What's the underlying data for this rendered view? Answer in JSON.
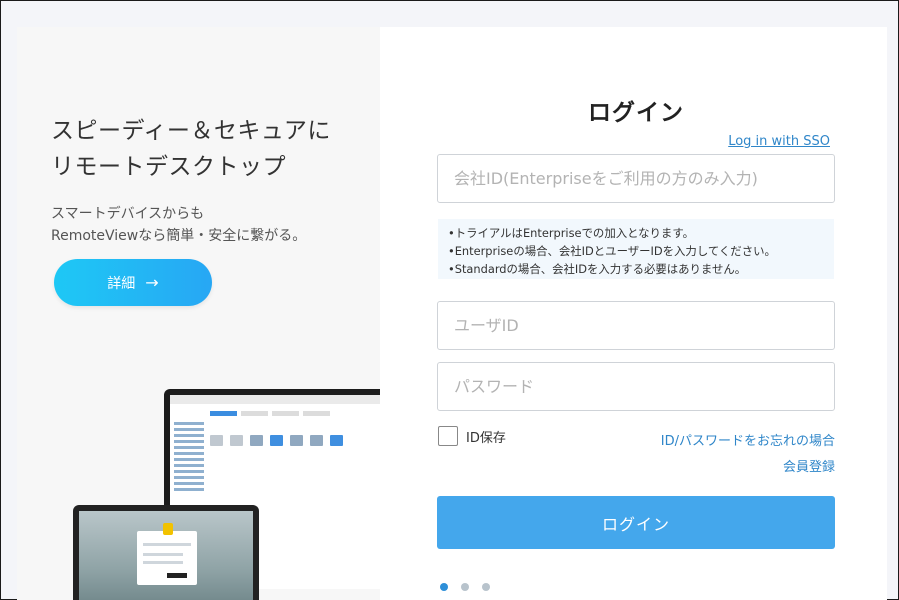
{
  "promo": {
    "headline_line1": "スピーディー＆セキュアに",
    "headline_line2": "リモートデスクトップ",
    "sub_line1": "スマートデバイスからも",
    "sub_line2": "RemoteViewなら簡単・安全に繋がる。",
    "detail_button": "詳細",
    "detail_arrow": "→"
  },
  "login": {
    "title": "ログイン",
    "sso_link": "Log in with SSO",
    "company_id_placeholder": "会社ID(Enterpriseをご利用の方のみ入力)",
    "notice": [
      "•トライアルはEnterpriseでの加入となります。",
      "•Enterpriseの場合、会社IDとユーザーIDを入力してください。",
      "•Standardの場合、会社IDを入力する必要はありません。"
    ],
    "user_id_placeholder": "ユーザID",
    "password_placeholder": "パスワード",
    "save_id_label": "ID保存",
    "forgot_link": "ID/パスワードをお忘れの場合",
    "register_link": "会員登録",
    "login_button": "ログイン"
  },
  "carousel": {
    "count": 3,
    "active_index": 0
  },
  "colors": {
    "accent": "#44a7ec",
    "link": "#2f86c9",
    "detail_gradient_start": "#1ec8f5",
    "detail_gradient_end": "#27a7f4"
  }
}
